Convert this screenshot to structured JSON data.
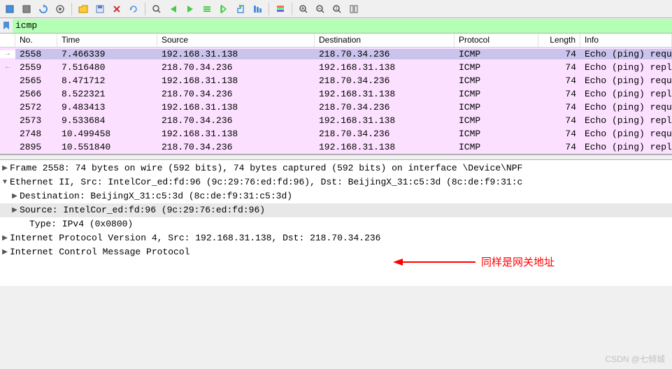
{
  "filter": {
    "value": "icmp"
  },
  "columns": {
    "no": "No.",
    "time": "Time",
    "source": "Source",
    "destination": "Destination",
    "protocol": "Protocol",
    "length": "Length",
    "info": "Info"
  },
  "packets": [
    {
      "no": "2558",
      "time": "7.466339",
      "src": "192.168.31.138",
      "dst": "218.70.34.236",
      "proto": "ICMP",
      "len": "74",
      "info": "Echo (ping) requ",
      "selected": true,
      "gutter": "→"
    },
    {
      "no": "2559",
      "time": "7.516480",
      "src": "218.70.34.236",
      "dst": "192.168.31.138",
      "proto": "ICMP",
      "len": "74",
      "info": "Echo (ping) repl",
      "selected": false,
      "gutter": "←"
    },
    {
      "no": "2565",
      "time": "8.471712",
      "src": "192.168.31.138",
      "dst": "218.70.34.236",
      "proto": "ICMP",
      "len": "74",
      "info": "Echo (ping) requ",
      "selected": false,
      "gutter": ""
    },
    {
      "no": "2566",
      "time": "8.522321",
      "src": "218.70.34.236",
      "dst": "192.168.31.138",
      "proto": "ICMP",
      "len": "74",
      "info": "Echo (ping) repl",
      "selected": false,
      "gutter": ""
    },
    {
      "no": "2572",
      "time": "9.483413",
      "src": "192.168.31.138",
      "dst": "218.70.34.236",
      "proto": "ICMP",
      "len": "74",
      "info": "Echo (ping) requ",
      "selected": false,
      "gutter": ""
    },
    {
      "no": "2573",
      "time": "9.533684",
      "src": "218.70.34.236",
      "dst": "192.168.31.138",
      "proto": "ICMP",
      "len": "74",
      "info": "Echo (ping) repl",
      "selected": false,
      "gutter": ""
    },
    {
      "no": "2748",
      "time": "10.499458",
      "src": "192.168.31.138",
      "dst": "218.70.34.236",
      "proto": "ICMP",
      "len": "74",
      "info": "Echo (ping) requ",
      "selected": false,
      "gutter": ""
    },
    {
      "no": "2895",
      "time": "10.551840",
      "src": "218.70.34.236",
      "dst": "192.168.31.138",
      "proto": "ICMP",
      "len": "74",
      "info": "Echo (ping) repl",
      "selected": false,
      "gutter": ""
    }
  ],
  "details": {
    "frame": "Frame 2558: 74 bytes on wire (592 bits), 74 bytes captured (592 bits) on interface \\Device\\NPF",
    "eth": "Ethernet II, Src: IntelCor_ed:fd:96 (9c:29:76:ed:fd:96), Dst: BeijingX_31:c5:3d (8c:de:f9:31:c",
    "eth_dst": "Destination: BeijingX_31:c5:3d (8c:de:f9:31:c5:3d)",
    "eth_src": "Source: IntelCor_ed:fd:96 (9c:29:76:ed:fd:96)",
    "eth_type": "Type: IPv4 (0x0800)",
    "ipv4": "Internet Protocol Version 4, Src: 192.168.31.138, Dst: 218.70.34.236",
    "icmp": "Internet Control Message Protocol"
  },
  "annotation": "同样是网关地址",
  "watermark": "CSDN @七倾城",
  "colors": {
    "icmp_bg": "#fce0ff",
    "selected_bg": "#c8c4ec",
    "filter_valid_bg": "#b3ffb3",
    "annotation": "#ff0000"
  }
}
